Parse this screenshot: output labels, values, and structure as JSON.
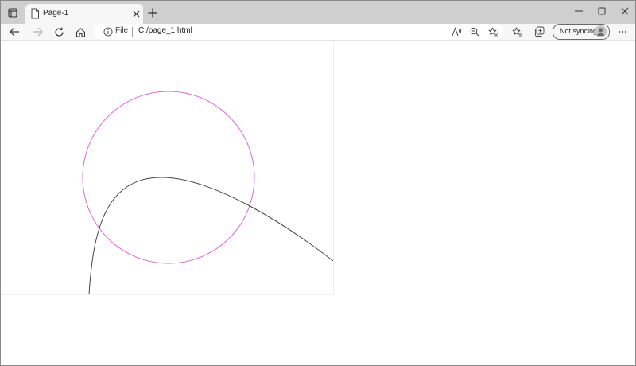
{
  "browser": {
    "tab": {
      "title": "Page-1",
      "favicon": "page-icon"
    },
    "new_tab_icon": "plus-icon",
    "window_controls": [
      "minimize-icon",
      "maximize-icon",
      "close-icon"
    ],
    "address": {
      "scheme_label": "File",
      "url": "C:/page_1.html",
      "info_icon": "info-icon"
    },
    "nav_icons": [
      "back-arrow-icon",
      "forward-arrow-icon",
      "refresh-icon",
      "home-icon"
    ],
    "address_icons": [
      "read-aloud-icon",
      "zoom-out-icon",
      "add-favorite-icon"
    ],
    "toolbar_icons": [
      "favorites-icon",
      "collections-icon",
      "more-icon"
    ],
    "profile": {
      "label": "Not syncing",
      "avatar_icon": "person-avatar-icon"
    }
  },
  "page": {
    "shapes": {
      "circle_stroke": "#dd66dd",
      "curve_stroke": "#444444"
    }
  }
}
